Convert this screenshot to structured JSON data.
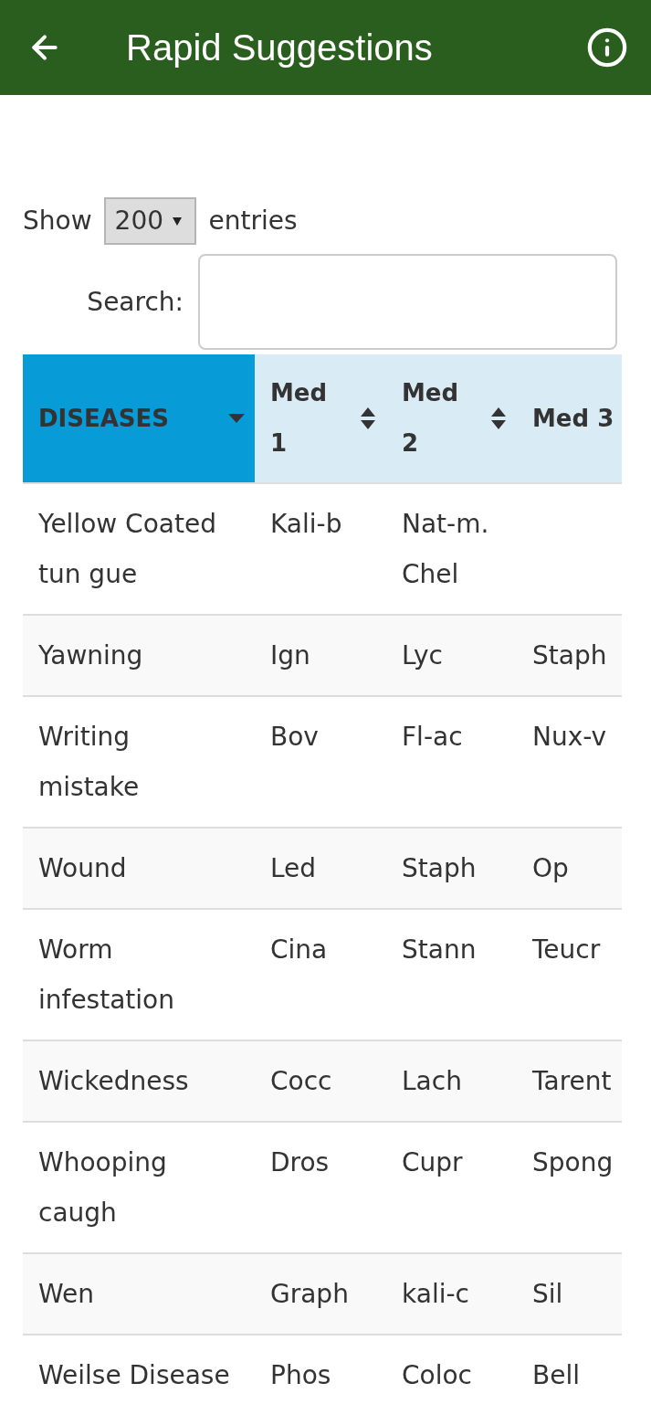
{
  "app_bar": {
    "title": "Rapid Suggestions"
  },
  "length_control": {
    "prefix": "Show",
    "value": "200",
    "suffix": "entries"
  },
  "search": {
    "label": "Search:"
  },
  "table": {
    "columns": [
      {
        "label": "DISEASES",
        "sorted": true
      },
      {
        "label": "Med 1",
        "sorted": false
      },
      {
        "label": "Med 2",
        "sorted": false
      },
      {
        "label": "Med 3"
      }
    ],
    "rows": [
      {
        "disease": "Yellow Coated tun gue",
        "medicines": [
          "Kali-b",
          "Nat-m. Chel"
        ]
      },
      {
        "disease": "Yawning",
        "medicines": [
          "Ign",
          "Lyc",
          "Staph"
        ]
      },
      {
        "disease": "Writing mistake",
        "medicines": [
          "Bov",
          "Fl-ac",
          "Nux-v"
        ]
      },
      {
        "disease": "Wound",
        "medicines": [
          "Led",
          "Staph",
          "Op"
        ]
      },
      {
        "disease": "Worm infestation",
        "medicines": [
          "Cina",
          "Stann",
          "Teucr"
        ]
      },
      {
        "disease": "Wickedness",
        "medicines": [
          "Cocc",
          "Lach",
          "Tarent"
        ]
      },
      {
        "disease": "Whooping caugh",
        "medicines": [
          "Dros",
          "Cupr",
          "Spong"
        ]
      },
      {
        "disease": "Wen",
        "medicines": [
          "Graph",
          "kali-c",
          "Sil"
        ]
      },
      {
        "disease": "Weilse Disease",
        "medicines": [
          "Phos",
          "Coloc",
          "Bell"
        ]
      }
    ]
  }
}
